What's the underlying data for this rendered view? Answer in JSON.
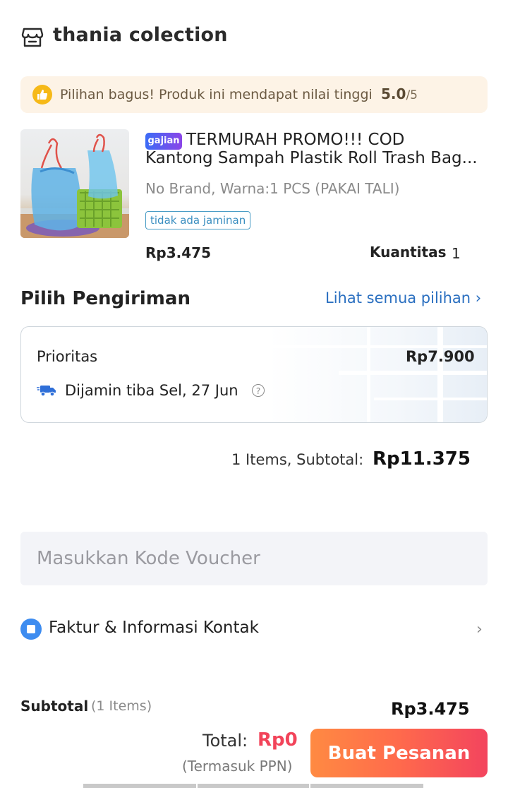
{
  "store": {
    "name": "thania colection",
    "icon": "store-icon"
  },
  "rating_banner": {
    "text": "Pilihan bagus! Produk ini mendapat nilai tinggi",
    "score": "5.0",
    "max": "/5",
    "icon": "thumbs-up-icon",
    "color": "#f6b918"
  },
  "product": {
    "badge": "gajian",
    "title_line1": "TERMURAH PROMO!!! COD",
    "title_line2": "Kantong Sampah Plastik Roll Trash Bag...",
    "variant": "No Brand, Warna:1 PCS (PAKAI TALI)",
    "warranty": "tidak ada jaminan",
    "price": "Rp3.475",
    "quantity_label": "Kuantitas",
    "quantity": "1"
  },
  "shipping": {
    "heading": "Pilih Pengiriman",
    "see_all": "Lihat semua pilihan ›",
    "option_name": "Prioritas",
    "option_price": "Rp7.900",
    "eta": "Dijamin tiba Sel, 27 Jun",
    "help": "?"
  },
  "subtotal": {
    "label": "1 Items, Subtotal:",
    "amount": "Rp11.375"
  },
  "voucher": {
    "placeholder": "Masukkan Kode Voucher"
  },
  "invoice": {
    "label": "Faktur & Informasi Kontak",
    "chevron": "›"
  },
  "summary": {
    "label": "Subtotal",
    "count": "(1 Items)",
    "amount": "Rp3.475"
  },
  "footer": {
    "total_label": "Total:",
    "total_amount": "Rp0",
    "tax_note": "(Termasuk PPN)",
    "order_button": "Buat Pesanan",
    "accent": "#f2445a"
  }
}
